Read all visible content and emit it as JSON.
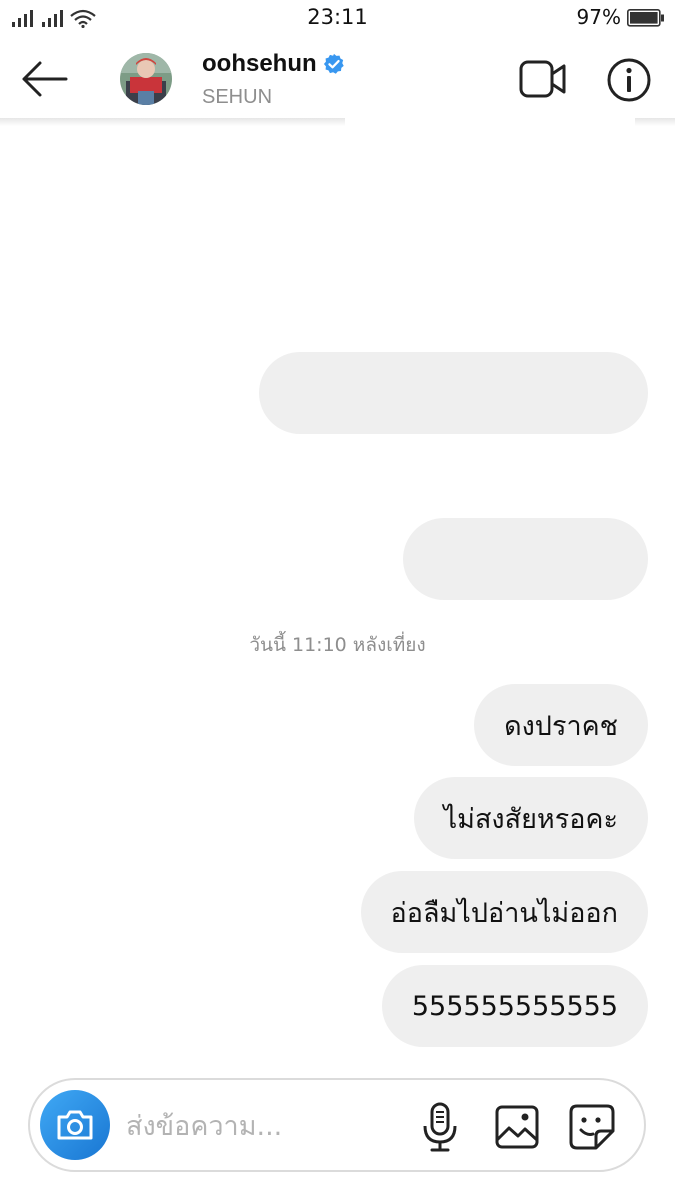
{
  "status_bar": {
    "time": "23:11",
    "battery_percent": "97%"
  },
  "header": {
    "username": "oohsehun",
    "full_name": "SEHUN",
    "verified": true,
    "icons": [
      "back-arrow-icon",
      "verified-badge-icon",
      "video-call-icon",
      "info-icon"
    ]
  },
  "messages": [
    {
      "text": "",
      "direction": "outgoing"
    },
    {
      "text": "",
      "direction": "outgoing"
    },
    {
      "text": "ดงปราคช",
      "direction": "outgoing"
    },
    {
      "text": "ไม่สงสัยหรอคะ",
      "direction": "outgoing"
    },
    {
      "text": "อ่อลืมไปอ่านไม่ออก",
      "direction": "outgoing"
    },
    {
      "text": "555555555555",
      "direction": "outgoing"
    }
  ],
  "timestamp": "วันนี้ 11:10 หลังเที่ยง",
  "composer": {
    "placeholder": "ส่งข้อความ...",
    "value": "",
    "icons": [
      "camera-icon",
      "microphone-icon",
      "gallery-icon",
      "sticker-icon"
    ]
  },
  "colors": {
    "bubble": "#efefef",
    "verified": "#3897f0",
    "camera_button": "#1e88e5",
    "muted_text": "#8e8e8e"
  }
}
